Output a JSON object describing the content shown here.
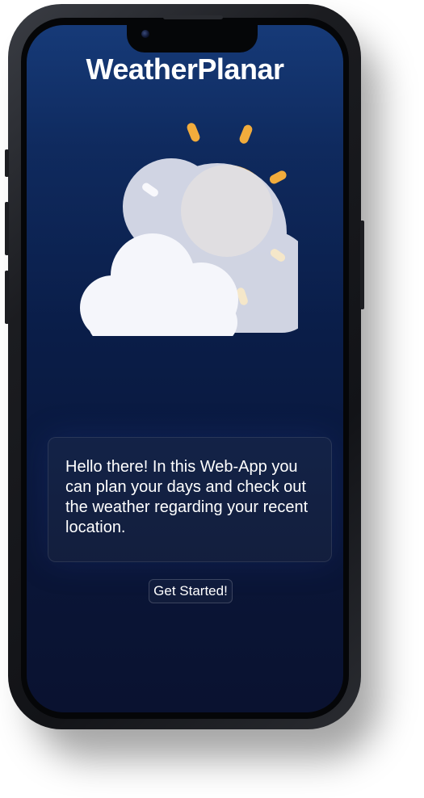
{
  "app": {
    "title": "WeatherPlanar"
  },
  "intro": {
    "text": "Hello there! In this Web-App you can plan your days and check out the weather regarding your recent location."
  },
  "cta": {
    "label": "Get Started!"
  },
  "illustration": {
    "icon": "partly-cloudy-sun-icon"
  },
  "colors": {
    "screen_top": "#163a78",
    "screen_bottom": "#0a1230",
    "sun": "#f2ac3c",
    "cloud_front": "#f5f6fb",
    "cloud_back": "#dfe2ee"
  }
}
